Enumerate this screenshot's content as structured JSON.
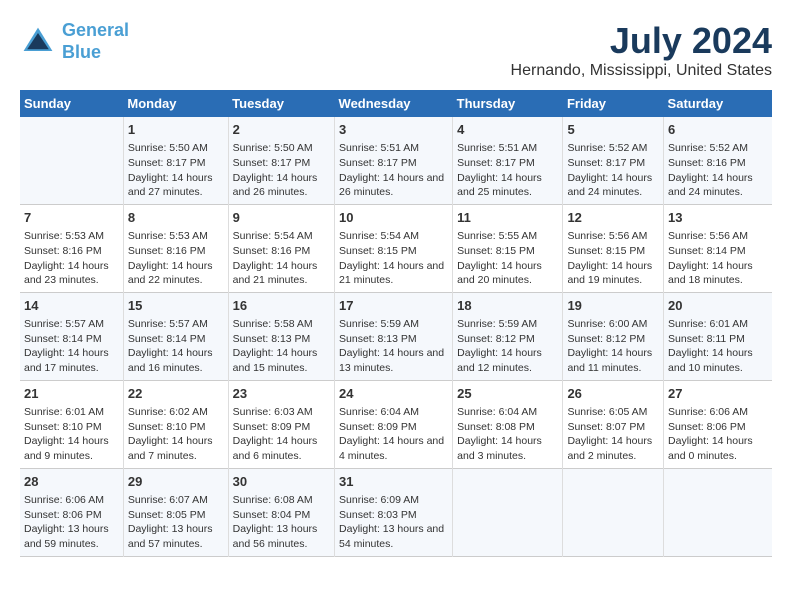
{
  "logo": {
    "line1": "General",
    "line2": "Blue"
  },
  "title": "July 2024",
  "subtitle": "Hernando, Mississippi, United States",
  "days_of_week": [
    "Sunday",
    "Monday",
    "Tuesday",
    "Wednesday",
    "Thursday",
    "Friday",
    "Saturday"
  ],
  "weeks": [
    [
      {
        "num": "",
        "sunrise": "",
        "sunset": "",
        "daylight": ""
      },
      {
        "num": "1",
        "sunrise": "Sunrise: 5:50 AM",
        "sunset": "Sunset: 8:17 PM",
        "daylight": "Daylight: 14 hours and 27 minutes."
      },
      {
        "num": "2",
        "sunrise": "Sunrise: 5:50 AM",
        "sunset": "Sunset: 8:17 PM",
        "daylight": "Daylight: 14 hours and 26 minutes."
      },
      {
        "num": "3",
        "sunrise": "Sunrise: 5:51 AM",
        "sunset": "Sunset: 8:17 PM",
        "daylight": "Daylight: 14 hours and 26 minutes."
      },
      {
        "num": "4",
        "sunrise": "Sunrise: 5:51 AM",
        "sunset": "Sunset: 8:17 PM",
        "daylight": "Daylight: 14 hours and 25 minutes."
      },
      {
        "num": "5",
        "sunrise": "Sunrise: 5:52 AM",
        "sunset": "Sunset: 8:17 PM",
        "daylight": "Daylight: 14 hours and 24 minutes."
      },
      {
        "num": "6",
        "sunrise": "Sunrise: 5:52 AM",
        "sunset": "Sunset: 8:16 PM",
        "daylight": "Daylight: 14 hours and 24 minutes."
      }
    ],
    [
      {
        "num": "7",
        "sunrise": "Sunrise: 5:53 AM",
        "sunset": "Sunset: 8:16 PM",
        "daylight": "Daylight: 14 hours and 23 minutes."
      },
      {
        "num": "8",
        "sunrise": "Sunrise: 5:53 AM",
        "sunset": "Sunset: 8:16 PM",
        "daylight": "Daylight: 14 hours and 22 minutes."
      },
      {
        "num": "9",
        "sunrise": "Sunrise: 5:54 AM",
        "sunset": "Sunset: 8:16 PM",
        "daylight": "Daylight: 14 hours and 21 minutes."
      },
      {
        "num": "10",
        "sunrise": "Sunrise: 5:54 AM",
        "sunset": "Sunset: 8:15 PM",
        "daylight": "Daylight: 14 hours and 21 minutes."
      },
      {
        "num": "11",
        "sunrise": "Sunrise: 5:55 AM",
        "sunset": "Sunset: 8:15 PM",
        "daylight": "Daylight: 14 hours and 20 minutes."
      },
      {
        "num": "12",
        "sunrise": "Sunrise: 5:56 AM",
        "sunset": "Sunset: 8:15 PM",
        "daylight": "Daylight: 14 hours and 19 minutes."
      },
      {
        "num": "13",
        "sunrise": "Sunrise: 5:56 AM",
        "sunset": "Sunset: 8:14 PM",
        "daylight": "Daylight: 14 hours and 18 minutes."
      }
    ],
    [
      {
        "num": "14",
        "sunrise": "Sunrise: 5:57 AM",
        "sunset": "Sunset: 8:14 PM",
        "daylight": "Daylight: 14 hours and 17 minutes."
      },
      {
        "num": "15",
        "sunrise": "Sunrise: 5:57 AM",
        "sunset": "Sunset: 8:14 PM",
        "daylight": "Daylight: 14 hours and 16 minutes."
      },
      {
        "num": "16",
        "sunrise": "Sunrise: 5:58 AM",
        "sunset": "Sunset: 8:13 PM",
        "daylight": "Daylight: 14 hours and 15 minutes."
      },
      {
        "num": "17",
        "sunrise": "Sunrise: 5:59 AM",
        "sunset": "Sunset: 8:13 PM",
        "daylight": "Daylight: 14 hours and 13 minutes."
      },
      {
        "num": "18",
        "sunrise": "Sunrise: 5:59 AM",
        "sunset": "Sunset: 8:12 PM",
        "daylight": "Daylight: 14 hours and 12 minutes."
      },
      {
        "num": "19",
        "sunrise": "Sunrise: 6:00 AM",
        "sunset": "Sunset: 8:12 PM",
        "daylight": "Daylight: 14 hours and 11 minutes."
      },
      {
        "num": "20",
        "sunrise": "Sunrise: 6:01 AM",
        "sunset": "Sunset: 8:11 PM",
        "daylight": "Daylight: 14 hours and 10 minutes."
      }
    ],
    [
      {
        "num": "21",
        "sunrise": "Sunrise: 6:01 AM",
        "sunset": "Sunset: 8:10 PM",
        "daylight": "Daylight: 14 hours and 9 minutes."
      },
      {
        "num": "22",
        "sunrise": "Sunrise: 6:02 AM",
        "sunset": "Sunset: 8:10 PM",
        "daylight": "Daylight: 14 hours and 7 minutes."
      },
      {
        "num": "23",
        "sunrise": "Sunrise: 6:03 AM",
        "sunset": "Sunset: 8:09 PM",
        "daylight": "Daylight: 14 hours and 6 minutes."
      },
      {
        "num": "24",
        "sunrise": "Sunrise: 6:04 AM",
        "sunset": "Sunset: 8:09 PM",
        "daylight": "Daylight: 14 hours and 4 minutes."
      },
      {
        "num": "25",
        "sunrise": "Sunrise: 6:04 AM",
        "sunset": "Sunset: 8:08 PM",
        "daylight": "Daylight: 14 hours and 3 minutes."
      },
      {
        "num": "26",
        "sunrise": "Sunrise: 6:05 AM",
        "sunset": "Sunset: 8:07 PM",
        "daylight": "Daylight: 14 hours and 2 minutes."
      },
      {
        "num": "27",
        "sunrise": "Sunrise: 6:06 AM",
        "sunset": "Sunset: 8:06 PM",
        "daylight": "Daylight: 14 hours and 0 minutes."
      }
    ],
    [
      {
        "num": "28",
        "sunrise": "Sunrise: 6:06 AM",
        "sunset": "Sunset: 8:06 PM",
        "daylight": "Daylight: 13 hours and 59 minutes."
      },
      {
        "num": "29",
        "sunrise": "Sunrise: 6:07 AM",
        "sunset": "Sunset: 8:05 PM",
        "daylight": "Daylight: 13 hours and 57 minutes."
      },
      {
        "num": "30",
        "sunrise": "Sunrise: 6:08 AM",
        "sunset": "Sunset: 8:04 PM",
        "daylight": "Daylight: 13 hours and 56 minutes."
      },
      {
        "num": "31",
        "sunrise": "Sunrise: 6:09 AM",
        "sunset": "Sunset: 8:03 PM",
        "daylight": "Daylight: 13 hours and 54 minutes."
      },
      {
        "num": "",
        "sunrise": "",
        "sunset": "",
        "daylight": ""
      },
      {
        "num": "",
        "sunrise": "",
        "sunset": "",
        "daylight": ""
      },
      {
        "num": "",
        "sunrise": "",
        "sunset": "",
        "daylight": ""
      }
    ]
  ]
}
